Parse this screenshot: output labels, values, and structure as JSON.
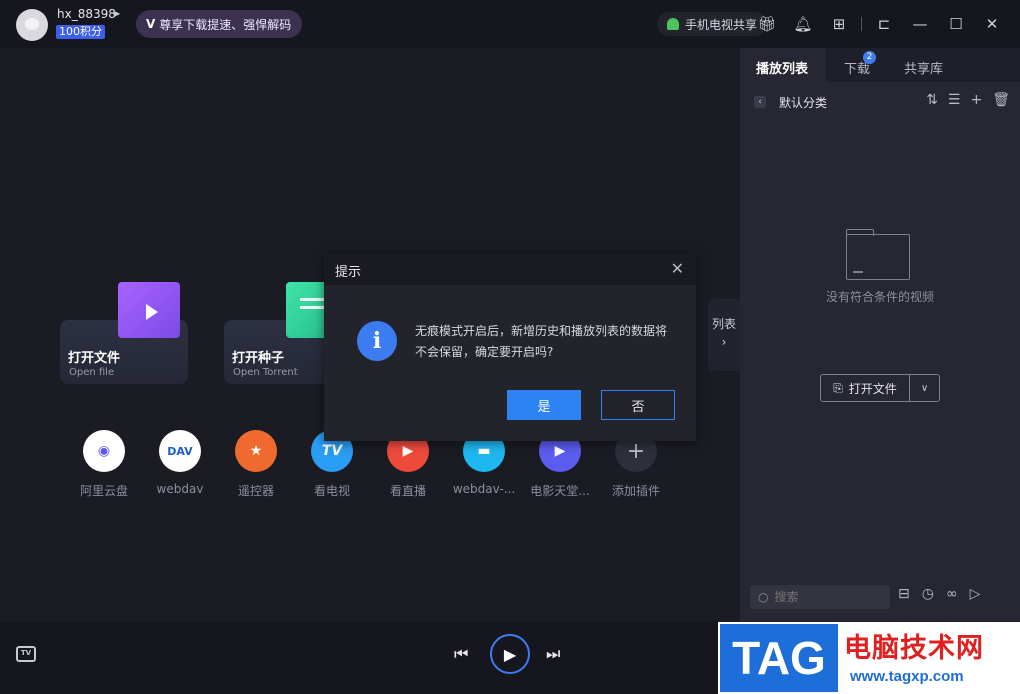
{
  "header": {
    "username": "hx_88398",
    "points": "100积分",
    "vip_text": "尊享下载提速、强悍解码",
    "phone_tv_label": "手机电视共享"
  },
  "main": {
    "cards": [
      {
        "title": "打开文件",
        "subtitle": "Open file"
      },
      {
        "title": "打开种子",
        "subtitle": "Open Torrent"
      }
    ],
    "plugins": [
      {
        "label": "阿里云盘",
        "icon": "aliyun-icon",
        "color": "#ffffff"
      },
      {
        "label": "webdav",
        "icon": "webdav-icon",
        "color": "#ffffff"
      },
      {
        "label": "遥控器",
        "icon": "star-icon",
        "color": "#f06a30"
      },
      {
        "label": "看电视",
        "icon": "tv-icon",
        "color": "#2a9df4"
      },
      {
        "label": "看直播",
        "icon": "play-icon",
        "color": "#ef4b3d"
      },
      {
        "label": "webdav-...",
        "icon": "webdav-icon",
        "color": "#1fb7f0"
      },
      {
        "label": "电影天堂...",
        "icon": "play-icon",
        "color": "#5b5cf0"
      },
      {
        "label": "添加插件",
        "icon": "add-icon",
        "color": "#2e2f3a"
      }
    ],
    "list_toggle": "列表"
  },
  "panel": {
    "tabs": [
      "播放列表",
      "下载",
      "共享库"
    ],
    "download_badge": "2",
    "category": "默认分类",
    "empty_text": "没有符合条件的视频",
    "open_file_button": "打开文件",
    "search_placeholder": "搜索"
  },
  "dialog": {
    "title": "提示",
    "message": "无痕模式开启后，新增历史和播放列表的数据将不会保留，确定要开启吗?",
    "yes": "是",
    "no": "否"
  },
  "watermark": {
    "tag": "TAG",
    "site_name": "电脑技术网",
    "url": "www.tagxp.com"
  }
}
